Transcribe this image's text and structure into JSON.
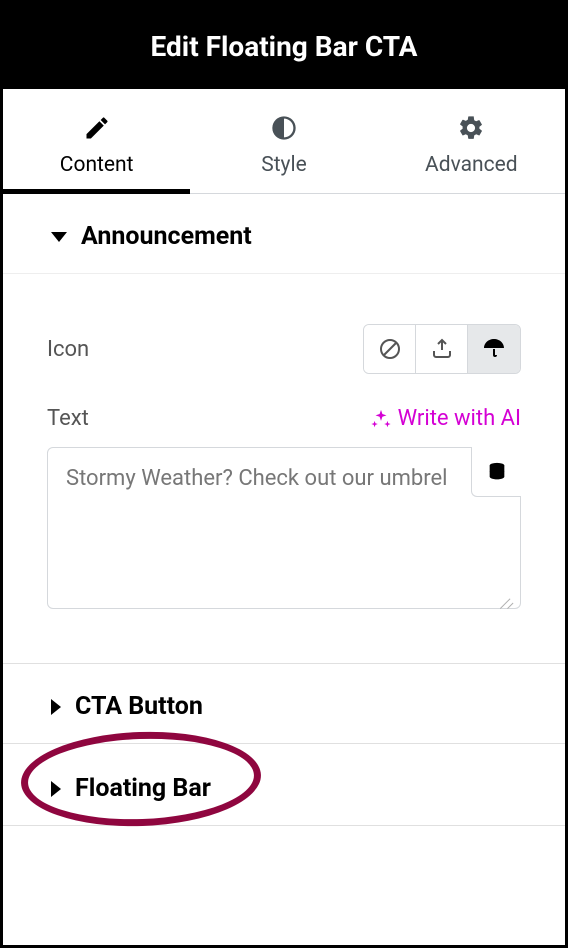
{
  "header": {
    "title": "Edit Floating Bar CTA"
  },
  "tabs": {
    "content": "Content",
    "style": "Style",
    "advanced": "Advanced",
    "active": "content"
  },
  "sections": {
    "announcement": {
      "title": "Announcement",
      "expanded": true,
      "iconLabel": "Icon",
      "textLabel": "Text",
      "writeAi": "Write with AI",
      "textValue": "Stormy Weather? Check out our umbrel"
    },
    "ctaButton": {
      "title": "CTA Button",
      "expanded": false
    },
    "floatingBar": {
      "title": "Floating Bar",
      "expanded": false
    }
  }
}
